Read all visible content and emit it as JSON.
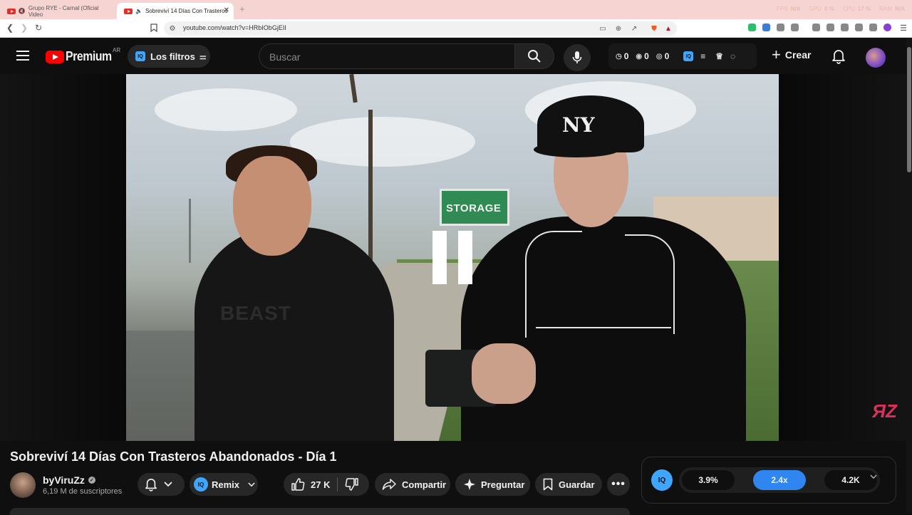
{
  "browser": {
    "tabs": [
      {
        "title": "Grupo RYE - Carnal (Oficial Video",
        "active": false
      },
      {
        "title": "Sobreviví 14 Días Con Trasteros",
        "active": true
      }
    ],
    "url": "youtube.com/watch?v=HRbIObGjEII",
    "metrics": {
      "fps_label": "FPS",
      "fps_value": "N/A",
      "gpu_label": "GPU",
      "gpu_value": "0 %",
      "cpu_label": "CPU",
      "cpu_value": "17 %",
      "ram_label": "RAM",
      "ram_value": "N/A"
    }
  },
  "masthead": {
    "logo_text": "Premium",
    "country_code": "AR",
    "filters_label": "Los filtros",
    "search_placeholder": "Buscar",
    "stats": [
      "0",
      "0",
      "0"
    ],
    "create_label": "Crear"
  },
  "video": {
    "title": "Sobreviví 14 Días Con Trasteros Abandonados - Día 1",
    "sign_text": "STORAGE",
    "shirt_text": "BEAST",
    "cap_text": "NY",
    "watermark": "ЯZ",
    "paused": true
  },
  "channel": {
    "name": "byViruZz",
    "subscribers": "6,19 M de suscriptores"
  },
  "actions": {
    "remix_label": "Remix",
    "like_count": "27 K",
    "share_label": "Compartir",
    "ask_label": "Preguntar",
    "save_label": "Guardar"
  },
  "iq_panel": {
    "badge": "IQ",
    "values": [
      "3.9%",
      "2.4x",
      "4.2K"
    ],
    "active_index": 1
  },
  "colors": {
    "accent": "#3ea6ff",
    "brand": "#ff0000",
    "segment_active": "#2f86f0"
  }
}
